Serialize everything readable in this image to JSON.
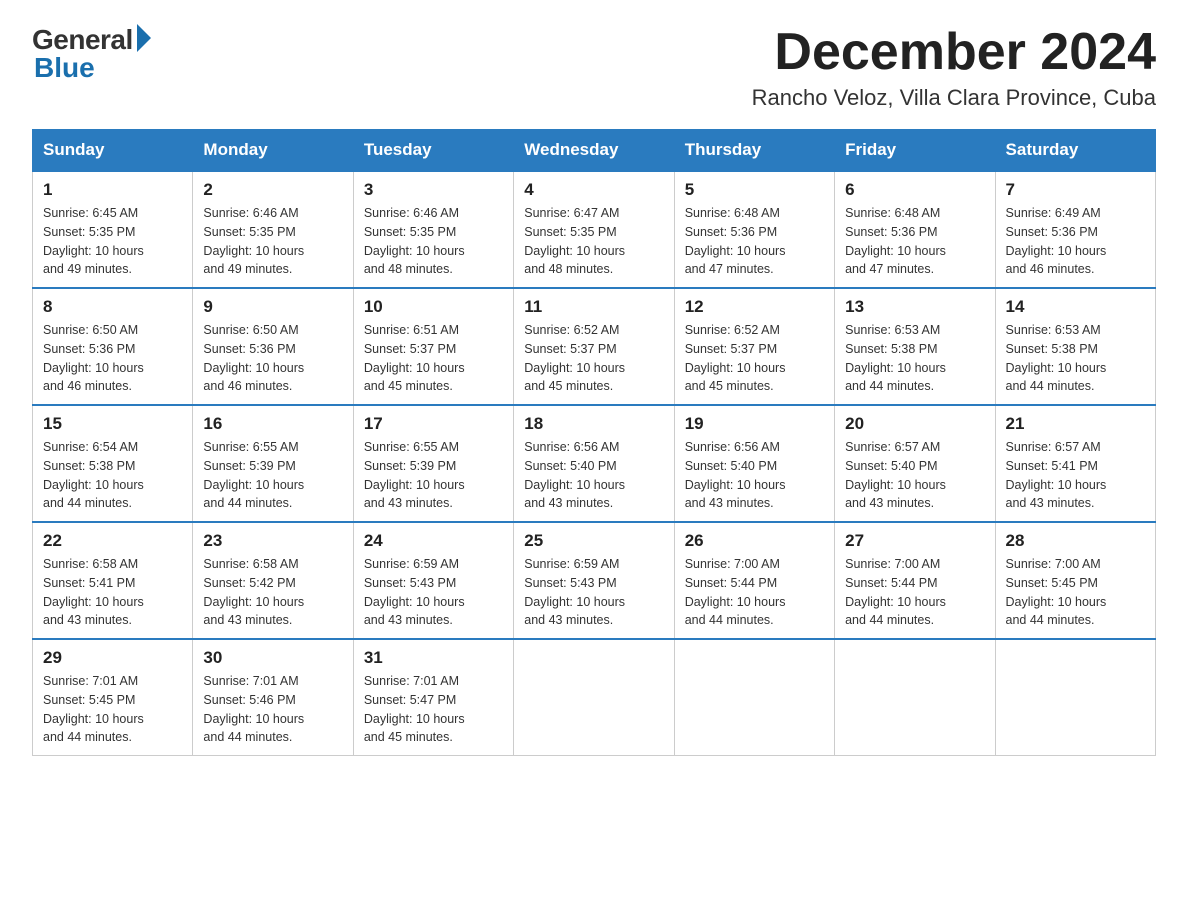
{
  "logo": {
    "general_text": "General",
    "blue_text": "Blue"
  },
  "title": {
    "month_year": "December 2024",
    "location": "Rancho Veloz, Villa Clara Province, Cuba"
  },
  "days_of_week": [
    "Sunday",
    "Monday",
    "Tuesday",
    "Wednesday",
    "Thursday",
    "Friday",
    "Saturday"
  ],
  "weeks": [
    [
      {
        "day": "1",
        "sunrise": "6:45 AM",
        "sunset": "5:35 PM",
        "daylight": "10 hours and 49 minutes."
      },
      {
        "day": "2",
        "sunrise": "6:46 AM",
        "sunset": "5:35 PM",
        "daylight": "10 hours and 49 minutes."
      },
      {
        "day": "3",
        "sunrise": "6:46 AM",
        "sunset": "5:35 PM",
        "daylight": "10 hours and 48 minutes."
      },
      {
        "day": "4",
        "sunrise": "6:47 AM",
        "sunset": "5:35 PM",
        "daylight": "10 hours and 48 minutes."
      },
      {
        "day": "5",
        "sunrise": "6:48 AM",
        "sunset": "5:36 PM",
        "daylight": "10 hours and 47 minutes."
      },
      {
        "day": "6",
        "sunrise": "6:48 AM",
        "sunset": "5:36 PM",
        "daylight": "10 hours and 47 minutes."
      },
      {
        "day": "7",
        "sunrise": "6:49 AM",
        "sunset": "5:36 PM",
        "daylight": "10 hours and 46 minutes."
      }
    ],
    [
      {
        "day": "8",
        "sunrise": "6:50 AM",
        "sunset": "5:36 PM",
        "daylight": "10 hours and 46 minutes."
      },
      {
        "day": "9",
        "sunrise": "6:50 AM",
        "sunset": "5:36 PM",
        "daylight": "10 hours and 46 minutes."
      },
      {
        "day": "10",
        "sunrise": "6:51 AM",
        "sunset": "5:37 PM",
        "daylight": "10 hours and 45 minutes."
      },
      {
        "day": "11",
        "sunrise": "6:52 AM",
        "sunset": "5:37 PM",
        "daylight": "10 hours and 45 minutes."
      },
      {
        "day": "12",
        "sunrise": "6:52 AM",
        "sunset": "5:37 PM",
        "daylight": "10 hours and 45 minutes."
      },
      {
        "day": "13",
        "sunrise": "6:53 AM",
        "sunset": "5:38 PM",
        "daylight": "10 hours and 44 minutes."
      },
      {
        "day": "14",
        "sunrise": "6:53 AM",
        "sunset": "5:38 PM",
        "daylight": "10 hours and 44 minutes."
      }
    ],
    [
      {
        "day": "15",
        "sunrise": "6:54 AM",
        "sunset": "5:38 PM",
        "daylight": "10 hours and 44 minutes."
      },
      {
        "day": "16",
        "sunrise": "6:55 AM",
        "sunset": "5:39 PM",
        "daylight": "10 hours and 44 minutes."
      },
      {
        "day": "17",
        "sunrise": "6:55 AM",
        "sunset": "5:39 PM",
        "daylight": "10 hours and 43 minutes."
      },
      {
        "day": "18",
        "sunrise": "6:56 AM",
        "sunset": "5:40 PM",
        "daylight": "10 hours and 43 minutes."
      },
      {
        "day": "19",
        "sunrise": "6:56 AM",
        "sunset": "5:40 PM",
        "daylight": "10 hours and 43 minutes."
      },
      {
        "day": "20",
        "sunrise": "6:57 AM",
        "sunset": "5:40 PM",
        "daylight": "10 hours and 43 minutes."
      },
      {
        "day": "21",
        "sunrise": "6:57 AM",
        "sunset": "5:41 PM",
        "daylight": "10 hours and 43 minutes."
      }
    ],
    [
      {
        "day": "22",
        "sunrise": "6:58 AM",
        "sunset": "5:41 PM",
        "daylight": "10 hours and 43 minutes."
      },
      {
        "day": "23",
        "sunrise": "6:58 AM",
        "sunset": "5:42 PM",
        "daylight": "10 hours and 43 minutes."
      },
      {
        "day": "24",
        "sunrise": "6:59 AM",
        "sunset": "5:43 PM",
        "daylight": "10 hours and 43 minutes."
      },
      {
        "day": "25",
        "sunrise": "6:59 AM",
        "sunset": "5:43 PM",
        "daylight": "10 hours and 43 minutes."
      },
      {
        "day": "26",
        "sunrise": "7:00 AM",
        "sunset": "5:44 PM",
        "daylight": "10 hours and 44 minutes."
      },
      {
        "day": "27",
        "sunrise": "7:00 AM",
        "sunset": "5:44 PM",
        "daylight": "10 hours and 44 minutes."
      },
      {
        "day": "28",
        "sunrise": "7:00 AM",
        "sunset": "5:45 PM",
        "daylight": "10 hours and 44 minutes."
      }
    ],
    [
      {
        "day": "29",
        "sunrise": "7:01 AM",
        "sunset": "5:45 PM",
        "daylight": "10 hours and 44 minutes."
      },
      {
        "day": "30",
        "sunrise": "7:01 AM",
        "sunset": "5:46 PM",
        "daylight": "10 hours and 44 minutes."
      },
      {
        "day": "31",
        "sunrise": "7:01 AM",
        "sunset": "5:47 PM",
        "daylight": "10 hours and 45 minutes."
      },
      null,
      null,
      null,
      null
    ]
  ],
  "labels": {
    "sunrise": "Sunrise:",
    "sunset": "Sunset:",
    "daylight": "Daylight:"
  }
}
